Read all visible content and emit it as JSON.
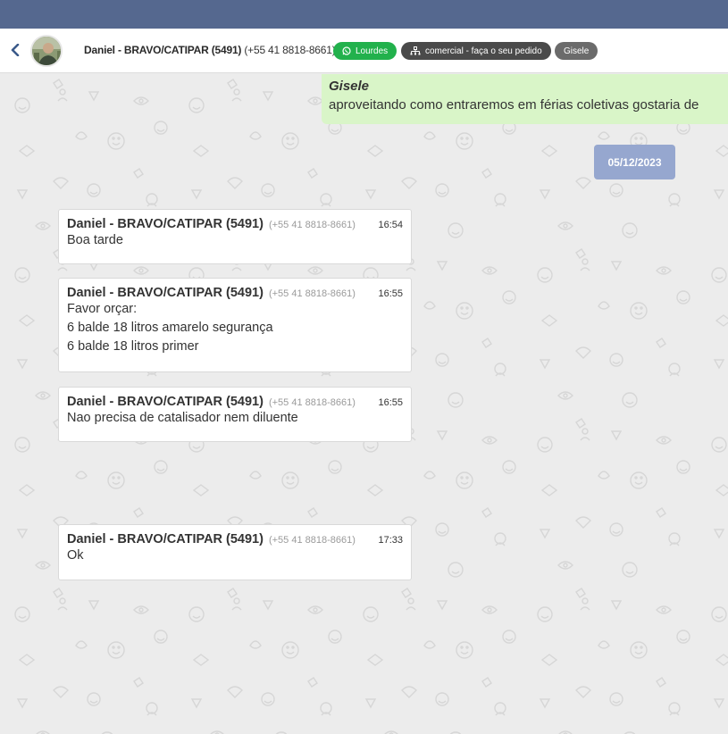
{
  "header": {
    "contact_name": "Daniel - BRAVO/CATIPAR (5491)",
    "contact_phone": "(+55 41 8818-8661)",
    "tags": [
      {
        "label": "Lourdes",
        "icon": "whatsapp-icon",
        "color": "#22b14c"
      },
      {
        "label": "comercial - faça o seu pedido",
        "icon": "sitemap-icon",
        "color": "#4a4a4a"
      },
      {
        "label": "Gisele",
        "color": "#6b6b6b"
      }
    ]
  },
  "sent_message": {
    "author": "Gisele",
    "text": "aproveitando como entraremos em férias coletivas gostaria de"
  },
  "date_separator": "05/12/2023",
  "messages": [
    {
      "name": "Daniel - BRAVO/CATIPAR (5491)",
      "phone": "(+55 41 8818-8661)",
      "time": "16:54",
      "lines": [
        "Boa tarde"
      ]
    },
    {
      "name": "Daniel - BRAVO/CATIPAR (5491)",
      "phone": "(+55 41 8818-8661)",
      "time": "16:55",
      "lines": [
        "Favor orçar:",
        "6 balde 18 litros amarelo segurança",
        "6 balde 18 litros primer"
      ]
    },
    {
      "name": "Daniel - BRAVO/CATIPAR (5491)",
      "phone": "(+55 41 8818-8661)",
      "time": "16:55",
      "lines": [
        "Nao precisa de catalisador nem diluente"
      ]
    },
    {
      "name": "Daniel - BRAVO/CATIPAR (5491)",
      "phone": "(+55 41 8818-8661)",
      "time": "17:33",
      "lines": [
        "Ok"
      ]
    }
  ],
  "colors": {
    "topbar": "#55688f",
    "chat_background": "#ececec",
    "sent_bubble": "#d9f5c8",
    "date_pill": "#96a7cf"
  }
}
